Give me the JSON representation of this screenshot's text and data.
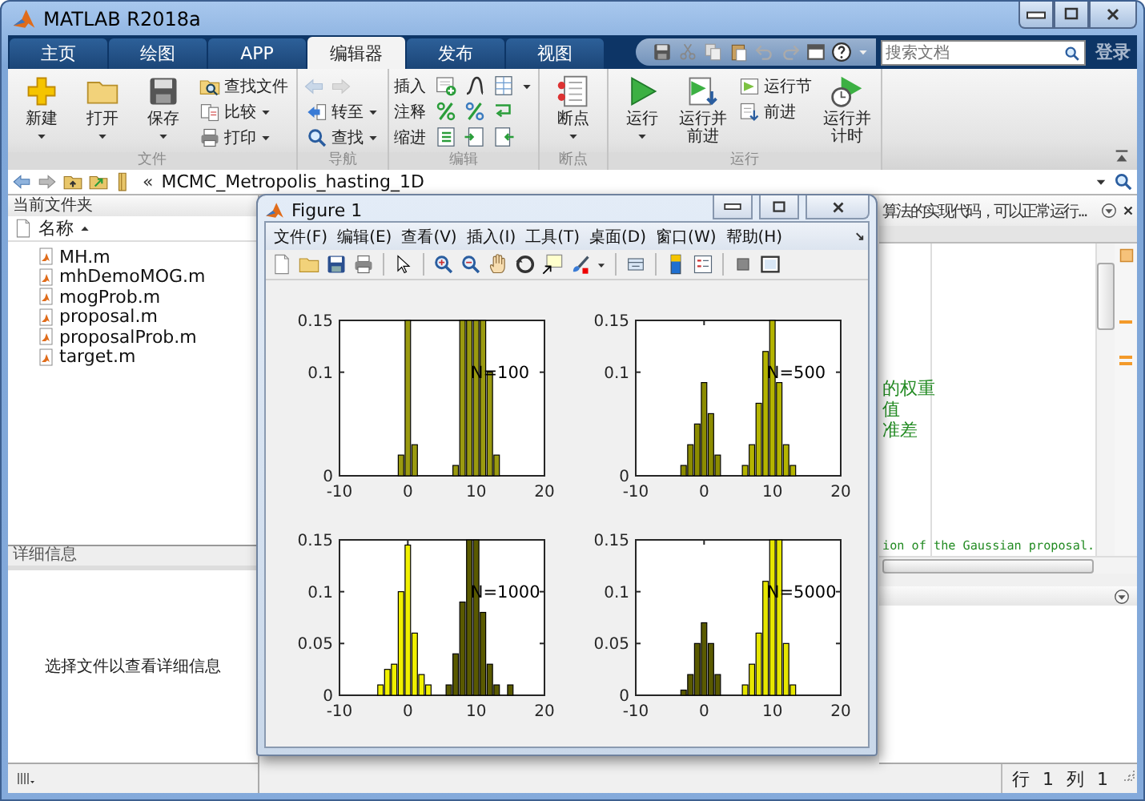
{
  "window": {
    "title": "MATLAB R2018a"
  },
  "tabs": [
    {
      "label": "主页",
      "selected": false
    },
    {
      "label": "绘图",
      "selected": false
    },
    {
      "label": "APP",
      "selected": false
    },
    {
      "label": "编辑器",
      "selected": true
    },
    {
      "label": "发布",
      "selected": false
    },
    {
      "label": "视图",
      "selected": false
    }
  ],
  "doc_search": {
    "placeholder": "搜索文档"
  },
  "sign_in": "登录",
  "ribbon": [
    {
      "label": "文件",
      "items": [
        {
          "kind": "large",
          "label": "新建",
          "dropdown": true
        },
        {
          "kind": "large",
          "label": "打开",
          "dropdown": true
        },
        {
          "kind": "large",
          "label": "保存",
          "dropdown": true
        },
        {
          "kind": "stack",
          "items": [
            {
              "kind": "button",
              "label": "查找文件",
              "dropdown": false
            },
            {
              "kind": "button",
              "label": "比较",
              "dropdown": true
            },
            {
              "kind": "button",
              "label": "打印",
              "dropdown": true
            }
          ]
        }
      ]
    },
    {
      "label": "导航",
      "items": [
        {
          "kind": "stack",
          "items": [
            {
              "kind": "arrows",
              "disabled": true
            },
            {
              "kind": "button",
              "label": "转至",
              "dropdown": true
            },
            {
              "kind": "button",
              "label": "查找",
              "dropdown": true
            }
          ]
        }
      ]
    },
    {
      "label": "编辑",
      "items": [
        {
          "kind": "stack",
          "items": [
            {
              "kind": "icon_row",
              "label": "插入",
              "dropdown": true
            },
            {
              "kind": "icon_row",
              "label": "注释",
              "dropdown": false
            },
            {
              "kind": "icon_row",
              "label": "缩进",
              "dropdown": false
            }
          ]
        }
      ]
    },
    {
      "label": "断点",
      "items": [
        {
          "kind": "large",
          "label": "断点",
          "dropdown": true
        }
      ]
    },
    {
      "label": "运行",
      "items": [
        {
          "kind": "large",
          "label": "运行",
          "dropdown": true
        },
        {
          "kind": "large",
          "label": "运行并前进",
          "dropdown": false
        },
        {
          "kind": "stack",
          "items": [
            {
              "kind": "button",
              "label": "运行节",
              "dropdown": false
            },
            {
              "kind": "button",
              "label": "前进",
              "dropdown": false
            }
          ]
        },
        {
          "kind": "large",
          "label": "运行并计时",
          "dropdown": false
        }
      ]
    }
  ],
  "address_bar": {
    "separator": "«",
    "path": "MCMC_Metropolis_hasting_1D"
  },
  "current_folder": {
    "title": "当前文件夹",
    "column": "名称",
    "files": [
      "MH.m",
      "mhDemoMOG.m",
      "mogProb.m",
      "proposal.m",
      "proposalProb.m",
      "target.m"
    ]
  },
  "details": {
    "title": "详细信息",
    "message": "选择文件以查看详细信息"
  },
  "editor": {
    "title": "算法的实现代码，可以正常运行...",
    "lines": [
      "的权重",
      "值",
      "准差",
      "ion of the Gaussian proposal."
    ]
  },
  "status_bar": {
    "row_label": "行",
    "row": "1",
    "column_label": "列",
    "column": "1"
  },
  "figure": {
    "title": "Figure 1",
    "menus": [
      "文件(F)",
      "编辑(E)",
      "查看(V)",
      "插入(I)",
      "工具(T)",
      "桌面(D)",
      "窗口(W)",
      "帮助(H)"
    ],
    "plots": [
      {
        "chart_data": {
          "type": "bar",
          "x": [
            -1,
            0,
            1,
            2,
            3,
            4,
            5,
            6,
            7,
            8,
            9,
            10,
            11,
            12,
            13
          ],
          "series": [
            {
              "color": "#9a9a10",
              "values": [
                0.02,
                0.15,
                0.03,
                null,
                null,
                null,
                null,
                null,
                0.01,
                0.15,
                0.15,
                0.15,
                0.15,
                0.1,
                0.02
              ]
            }
          ],
          "xlim": [
            -10,
            20
          ],
          "ylim": [
            0,
            0.15
          ],
          "xticks": [
            -10,
            0,
            10,
            20
          ],
          "yticks": [
            0,
            0.1,
            0.15
          ],
          "annotations": [
            "N=100"
          ]
        }
      },
      {
        "chart_data": {
          "type": "bar",
          "x": [
            -3,
            -2,
            -1,
            0,
            1,
            2,
            3,
            4,
            5,
            6,
            7,
            8,
            9,
            10,
            11,
            12,
            13
          ],
          "series": [
            {
              "color": "#8c8c00",
              "values": [
                0.01,
                0.03,
                0.05,
                0.09,
                0.06,
                0.02,
                null,
                null,
                null,
                null,
                null,
                null,
                null,
                null,
                null,
                null,
                null
              ]
            },
            {
              "color": "#b4b400",
              "values": [
                null,
                null,
                null,
                null,
                null,
                null,
                null,
                null,
                null,
                0.01,
                0.03,
                0.07,
                0.12,
                0.15,
                0.09,
                0.03,
                0.01
              ]
            }
          ],
          "xlim": [
            -10,
            20
          ],
          "ylim": [
            0,
            0.15
          ],
          "xticks": [
            -10,
            0,
            10,
            20
          ],
          "yticks": [
            0,
            0.1,
            0.15
          ],
          "annotations": [
            "N=500"
          ]
        }
      },
      {
        "chart_data": {
          "type": "bar",
          "x": [
            -4,
            -3,
            -2,
            -1,
            0,
            1,
            2,
            3,
            4,
            5,
            6,
            7,
            8,
            9,
            10,
            11,
            12,
            13,
            14,
            15
          ],
          "series": [
            {
              "color": "#f0f000",
              "values": [
                0.01,
                0.025,
                0.03,
                0.1,
                0.145,
                0.06,
                0.02,
                0.01,
                null,
                null,
                null,
                null,
                null,
                null,
                null,
                null,
                null,
                null,
                null,
                null
              ]
            },
            {
              "color": "#5a5a00",
              "values": [
                null,
                null,
                null,
                null,
                null,
                null,
                null,
                null,
                null,
                null,
                0.01,
                0.04,
                0.09,
                0.15,
                0.15,
                0.08,
                0.03,
                0.01,
                null,
                0.01
              ]
            }
          ],
          "xlim": [
            -10,
            20
          ],
          "ylim": [
            0,
            0.15
          ],
          "xticks": [
            -10,
            0,
            10,
            20
          ],
          "yticks": [
            0,
            0.05,
            0.1,
            0.15
          ],
          "annotations": [
            "N=1000"
          ]
        }
      },
      {
        "chart_data": {
          "type": "bar",
          "x": [
            -3,
            -2,
            -1,
            0,
            1,
            2,
            3,
            4,
            5,
            6,
            7,
            8,
            9,
            10,
            11,
            12,
            13
          ],
          "series": [
            {
              "color": "#5a5a00",
              "values": [
                0.005,
                0.02,
                0.05,
                0.07,
                0.05,
                0.02,
                null,
                null,
                null,
                null,
                null,
                null,
                null,
                null,
                null,
                null,
                null
              ]
            },
            {
              "color": "#e6e600",
              "values": [
                null,
                null,
                null,
                null,
                null,
                null,
                null,
                null,
                null,
                0.01,
                0.03,
                0.06,
                0.11,
                0.15,
                0.15,
                0.05,
                0.01
              ]
            }
          ],
          "xlim": [
            -10,
            20
          ],
          "ylim": [
            0,
            0.15
          ],
          "xticks": [
            -10,
            0,
            10,
            20
          ],
          "yticks": [
            0,
            0.05,
            0.1,
            0.15
          ],
          "annotations": [
            "N=5000"
          ]
        }
      }
    ]
  }
}
